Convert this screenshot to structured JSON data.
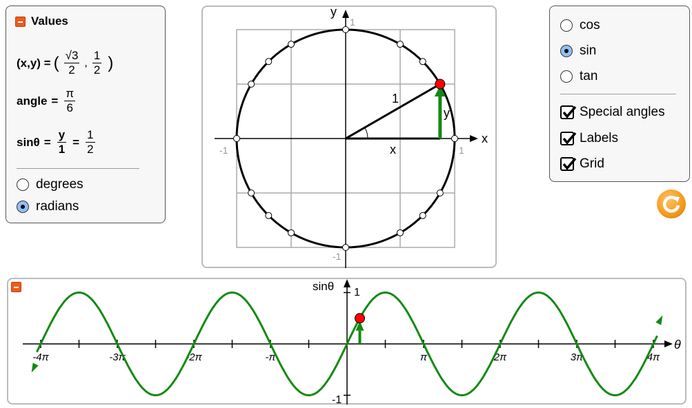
{
  "values_panel": {
    "title": "Values",
    "xy_label": "(x,y) =",
    "x_num": "√3",
    "x_den": "2",
    "y_num": "1",
    "y_den": "2",
    "comma": ",",
    "open_paren": "(",
    "close_paren": ")",
    "angle_label": "angle",
    "eq": "=",
    "angle_num": "π",
    "angle_den": "6",
    "sin_label": "sinθ",
    "sin_num1": "y",
    "sin_den1": "1",
    "sin_num2": "1",
    "sin_den2": "2",
    "units": [
      {
        "label": "degrees",
        "selected": false
      },
      {
        "label": "radians",
        "selected": true
      }
    ]
  },
  "unit_circle": {
    "angle_degrees": 30,
    "x_axis": "x",
    "y_axis": "y",
    "tick_pos": "1",
    "tick_neg": "-1",
    "hyp_label": "1",
    "x_leg": "x",
    "y_leg": "y",
    "grid": true,
    "special_angles": true
  },
  "function_panel": {
    "functions": [
      {
        "label": "cos",
        "selected": false
      },
      {
        "label": "sin",
        "selected": true
      },
      {
        "label": "tan",
        "selected": false
      }
    ],
    "checkboxes": [
      {
        "label": "Special angles",
        "checked": true
      },
      {
        "label": "Labels",
        "checked": true
      },
      {
        "label": "Grid",
        "checked": true
      }
    ]
  },
  "graph": {
    "ylabel": "sinθ",
    "xlabel": "θ",
    "y_top": "1",
    "y_bottom": "-1",
    "ticks": [
      "-4π",
      "-3π",
      "-2π",
      "-π",
      "π",
      "2π",
      "3π",
      "4π"
    ],
    "curve_color": "#138a13",
    "point_color": "#ff0000"
  },
  "colors": {
    "accent": "#f05a1a",
    "reset": "#f39a1e",
    "radio_selected": "#8fc0f5"
  }
}
